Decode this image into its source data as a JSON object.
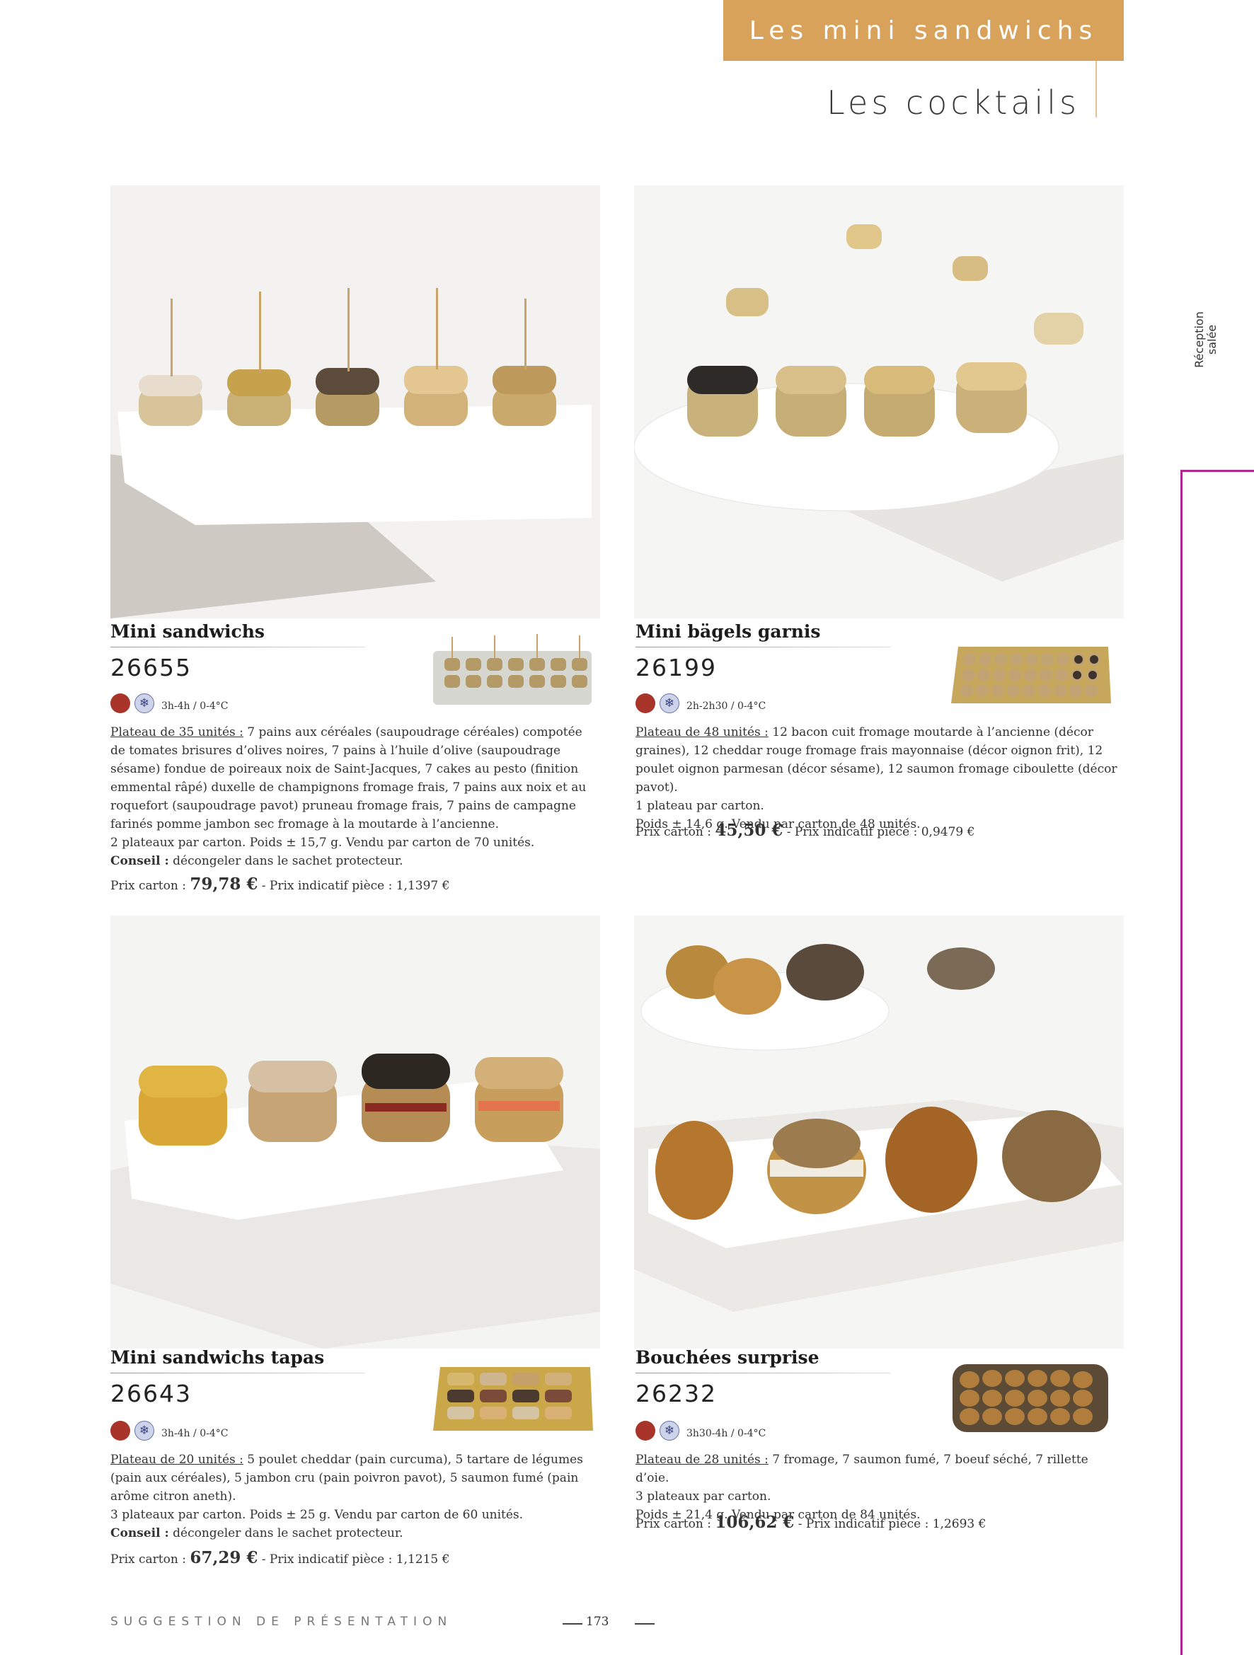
{
  "header": {
    "banner": "Les mini sandwichs",
    "subtitle": "Les cocktails"
  },
  "side_tab": {
    "line1": "Réception",
    "line2": "salée"
  },
  "products": [
    {
      "name": "Mini sandwichs",
      "code": "26655",
      "thaw": "3h-4h / 0-4°C",
      "desc_label": "Plateau de 35 unités :",
      "desc_text": " 7 pains aux céréales (saupoudrage céréales) compotée de tomates brisures d’olives noires, 7 pains à l’huile d’olive (saupoudrage sésame) fondue de poireaux noix de Saint-Jacques, 7 cakes au pesto (finition emmental râpé) duxelle de champignons fromage frais, 7 pains aux noix et au roquefort (saupoudrage pavot) pruneau fromage frais, 7 pains de campagne farinés pomme jambon sec fromage à la moutarde à l’ancienne.",
      "packing": "2 plateaux par carton. Poids ± 15,7 g. Vendu par carton de 70 unités.",
      "advice_label": "Conseil :",
      "advice": " décongeler dans le sachet protecteur.",
      "price_label": "Prix carton : ",
      "price": "79,78 €",
      "price_unit": " - Prix indicatif pièce : 1,1397 €"
    },
    {
      "name": "Mini bägels garnis",
      "code": "26199",
      "thaw": "2h-2h30 / 0-4°C",
      "desc_label": "Plateau de 48 unités :",
      "desc_text": " 12 bacon cuit fromage moutarde à l’ancienne (décor graines), 12 cheddar rouge fromage frais mayonnaise (décor oignon frit), 12 poulet oignon parmesan (décor sésame), 12 saumon fromage ciboulette (décor pavot).",
      "packing": "1 plateau par carton.",
      "packing2": "Poids ± 14,6 g. Vendu par carton de 48 unités.",
      "price_label": "Prix carton : ",
      "price": "45,50 €",
      "price_unit": " - Prix indicatif pièce : 0,9479 €"
    },
    {
      "name": "Mini sandwichs tapas",
      "code": "26643",
      "thaw": "3h-4h / 0-4°C",
      "desc_label": "Plateau de 20 unités :",
      "desc_text": " 5 poulet cheddar (pain curcuma), 5 tartare de légumes (pain aux céréales), 5 jambon cru (pain poivron pavot), 5 saumon fumé (pain arôme citron aneth).",
      "packing": "3 plateaux par carton. Poids ± 25 g. Vendu par carton de 60 unités.",
      "advice_label": "Conseil :",
      "advice": " décongeler dans le sachet protecteur.",
      "price_label": "Prix carton : ",
      "price": "67,29 €",
      "price_unit": " - Prix indicatif pièce : 1,1215 €"
    },
    {
      "name": "Bouchées surprise",
      "code": "26232",
      "thaw": "3h30-4h / 0-4°C",
      "desc_label": "Plateau de 28 unités :",
      "desc_text": " 7 fromage, 7 saumon fumé, 7 boeuf séché, 7 rillette d’oie.",
      "packing": "3 plateaux par carton.",
      "packing2": "Poids ± 21,4 g. Vendu par carton de 84 unités.",
      "price_label": "Prix carton : ",
      "price": "106,62 €",
      "price_unit": " - Prix indicatif pièce : 1,2693 €"
    }
  ],
  "footer": {
    "note": "SUGGESTION DE PRÉSENTATION",
    "page": "173"
  }
}
